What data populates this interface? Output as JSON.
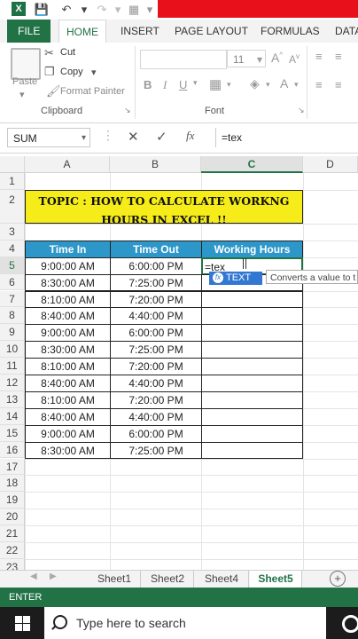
{
  "colors": {
    "excel_green": "#217346",
    "title_fill": "#f5ec1a",
    "header_fill": "#2e97c9",
    "title_bar_red": "#e8101b"
  },
  "ribbon": {
    "tabs": [
      "FILE",
      "HOME",
      "INSERT",
      "PAGE LAYOUT",
      "FORMULAS",
      "DATA"
    ],
    "clipboard": {
      "paste": "Paste",
      "cut": "Cut",
      "copy": "Copy",
      "format_painter": "Format Painter",
      "group_label": "Clipboard"
    },
    "font": {
      "font_size": "11",
      "group_label": "Font"
    }
  },
  "formula_bar": {
    "name_box": "SUM",
    "formula": "=tex"
  },
  "grid": {
    "columns": [
      "A",
      "B",
      "C",
      "D"
    ],
    "rows": [
      "1",
      "2",
      "3",
      "4",
      "5",
      "6",
      "7",
      "8",
      "9",
      "10",
      "11",
      "12",
      "13",
      "14",
      "15",
      "16",
      "17",
      "18",
      "19",
      "20",
      "21",
      "22",
      "23"
    ],
    "title_line1": "TOPIC : HOW TO CALCULATE WORKNG",
    "title_line2": "HOURS IN EXCEL !!",
    "headers": [
      "Time In",
      "Time Out",
      "Working Hours"
    ],
    "data": [
      [
        "9:00:00 AM",
        "6:00:00 PM"
      ],
      [
        "8:30:00 AM",
        "7:25:00 PM"
      ],
      [
        "8:10:00 AM",
        "7:20:00 PM"
      ],
      [
        "8:40:00 AM",
        "4:40:00 PM"
      ],
      [
        "9:00:00 AM",
        "6:00:00 PM"
      ],
      [
        "8:30:00 AM",
        "7:25:00 PM"
      ],
      [
        "8:10:00 AM",
        "7:20:00 PM"
      ],
      [
        "8:40:00 AM",
        "4:40:00 PM"
      ],
      [
        "8:10:00 AM",
        "7:20:00 PM"
      ],
      [
        "8:40:00 AM",
        "4:40:00 PM"
      ],
      [
        "9:00:00 AM",
        "6:00:00 PM"
      ],
      [
        "8:30:00 AM",
        "7:25:00 PM"
      ]
    ],
    "editing_value": "=tex"
  },
  "autocomplete": {
    "item": "TEXT",
    "tooltip": "Converts a value to t"
  },
  "sheets": [
    "Sheet1",
    "Sheet2",
    "Sheet4",
    "Sheet5"
  ],
  "status": "ENTER",
  "taskbar": {
    "search_placeholder": "Type here to search"
  }
}
